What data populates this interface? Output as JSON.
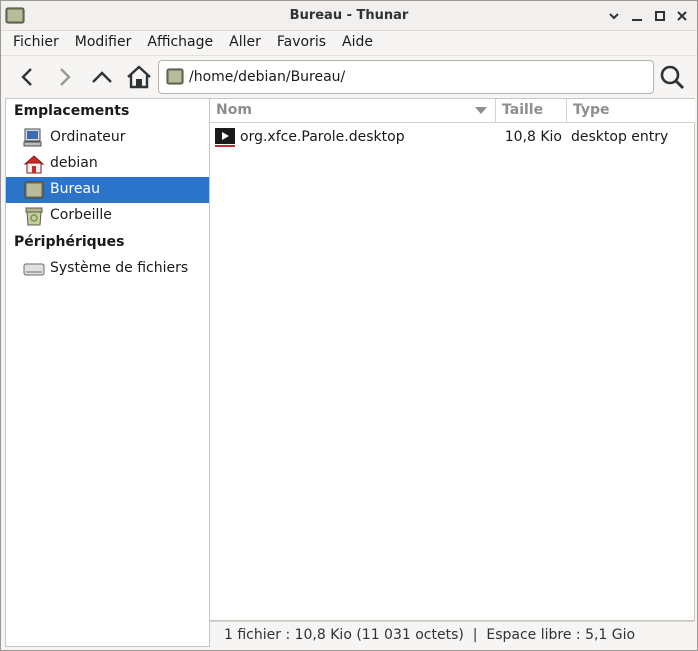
{
  "window": {
    "title": "Bureau - Thunar"
  },
  "menubar": {
    "items": [
      "Fichier",
      "Modifier",
      "Affichage",
      "Aller",
      "Favoris",
      "Aide"
    ]
  },
  "toolbar": {
    "location": "/home/debian/Bureau/"
  },
  "sidebar": {
    "sections": [
      {
        "heading": "Emplacements",
        "items": [
          {
            "label": "Ordinateur",
            "icon": "computer-icon"
          },
          {
            "label": "debian",
            "icon": "home-folder-icon"
          },
          {
            "label": "Bureau",
            "icon": "desktop-icon",
            "selected": true
          },
          {
            "label": "Corbeille",
            "icon": "trash-icon"
          }
        ]
      },
      {
        "heading": "Périphériques",
        "items": [
          {
            "label": "Système de fichiers",
            "icon": "drive-icon"
          }
        ]
      }
    ]
  },
  "columns": {
    "name": "Nom",
    "size": "Taille",
    "type": "Type"
  },
  "files": [
    {
      "name": "org.xfce.Parole.desktop",
      "size": "10,8 Kio",
      "type": "desktop entry",
      "icon": "media-player-icon"
    }
  ],
  "status": {
    "text": "1 fichier : 10,8 Kio (11 031 octets)  |  Espace libre : 5,1 Gio"
  },
  "colors": {
    "selection": "#2b74c9",
    "window_bg": "#f6f5f4"
  }
}
